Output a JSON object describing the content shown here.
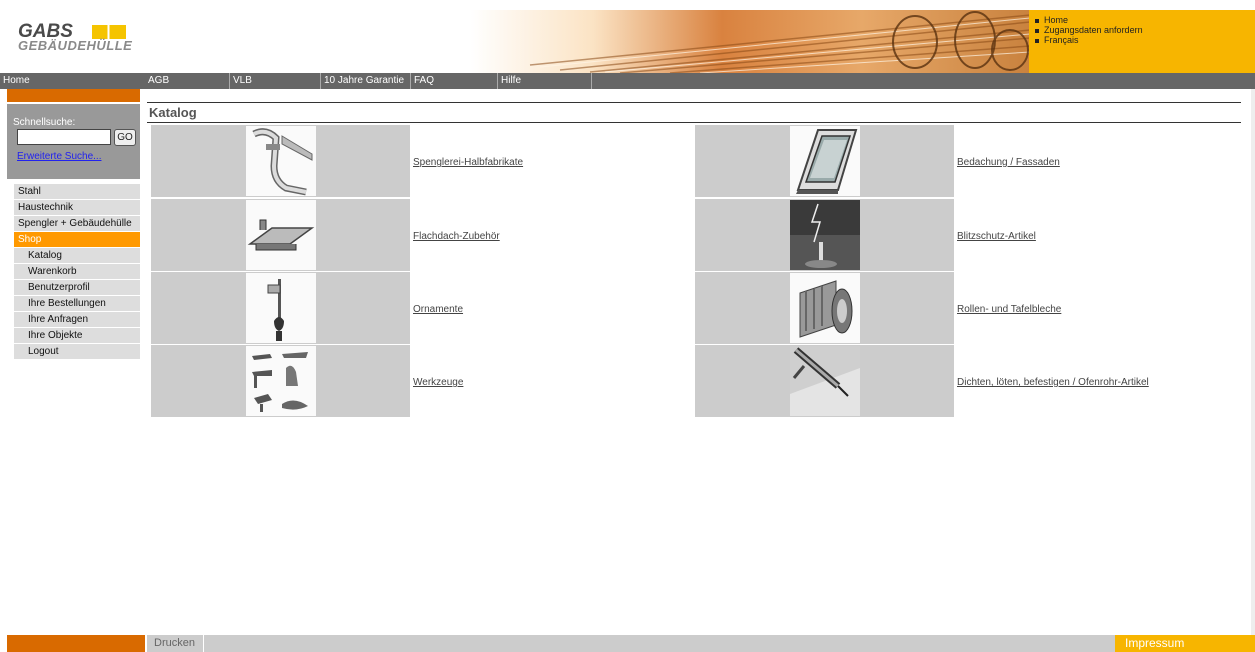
{
  "brand": {
    "line1": "GABS",
    "line2": "GEBÄUDEHÜLLE"
  },
  "topnav": [
    "Home",
    "Zugangsdaten anfordern",
    "Français"
  ],
  "mainnav": [
    "Home",
    "AGB",
    "VLB",
    "10 Jahre Garantie",
    "FAQ",
    "Hilfe"
  ],
  "search": {
    "label": "Schnellsuche:",
    "value": "",
    "go": "GO",
    "advanced": "Erweiterte Suche..."
  },
  "sidebar": {
    "items": [
      {
        "label": "Stahl"
      },
      {
        "label": "Haustechnik"
      },
      {
        "label": "Spengler + Gebäudehülle"
      },
      {
        "label": "Shop"
      },
      {
        "label": "Katalog"
      },
      {
        "label": "Warenkorb"
      },
      {
        "label": "Benutzerprofil"
      },
      {
        "label": "Ihre Bestellungen"
      },
      {
        "label": "Ihre Anfragen"
      },
      {
        "label": "Ihre Objekte"
      },
      {
        "label": "Logout"
      }
    ]
  },
  "catalog": {
    "title": "Katalog",
    "items": [
      {
        "label": "Spenglerei-Halbfabrikate",
        "icon": "gutter-pipe-icon"
      },
      {
        "label": "Bedachung / Fassaden",
        "icon": "roof-window-icon"
      },
      {
        "label": "Flachdach-Zubehör",
        "icon": "flat-roof-profile-icon"
      },
      {
        "label": "Blitzschutz-Artikel",
        "icon": "lightning-rod-icon"
      },
      {
        "label": "Ornamente",
        "icon": "ornament-finial-icon"
      },
      {
        "label": "Rollen- und Tafelbleche",
        "icon": "sheet-metal-rolls-icon"
      },
      {
        "label": "Werkzeuge",
        "icon": "tools-icon"
      },
      {
        "label": "Dichten, löten, befestigen / Ofenrohr-Artikel",
        "icon": "sealant-gun-icon"
      }
    ]
  },
  "footer": {
    "print": "Drucken",
    "impressum": "Impressum"
  }
}
